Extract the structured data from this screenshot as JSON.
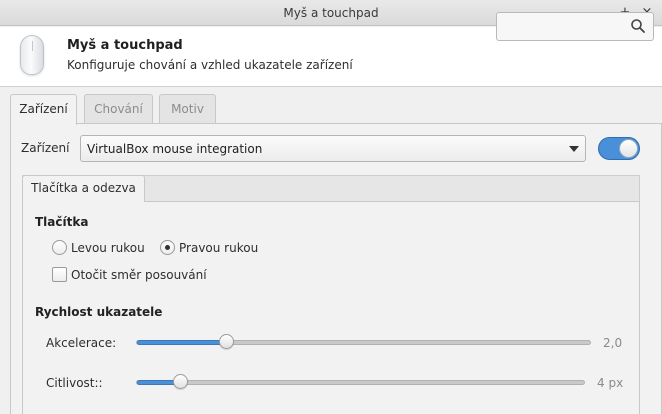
{
  "window": {
    "title": "Myš a touchpad",
    "controls": [
      "–",
      "+",
      "×"
    ]
  },
  "header": {
    "title": "Myš a touchpad",
    "subtitle": "Konfiguruje chování a vzhled ukazatele zařízení",
    "search_value": "",
    "search_icon": "search-icon"
  },
  "tabs": [
    {
      "label": "Zařízení",
      "active": true
    },
    {
      "label": "Chování",
      "active": false
    },
    {
      "label": "Motiv",
      "active": false
    }
  ],
  "device": {
    "label": "Zařízení",
    "selected": "VirtualBox mouse integration",
    "enabled": true
  },
  "subtabs": [
    {
      "label": "Tlačítka a odezva",
      "active": true
    }
  ],
  "buttons_section": {
    "title": "Tlačítka",
    "left_label": "Levou rukou",
    "right_label": "Pravou rukou",
    "selected": "right",
    "reverse_scroll_label": "Otočit směr posouvání",
    "reverse_scroll": false
  },
  "speed_section": {
    "title": "Rychlost ukazatele",
    "acceleration": {
      "label": "Akcelerace:",
      "value_text": "2,0",
      "fraction": 0.2
    },
    "sensitivity": {
      "label": "Citlivost::",
      "value_text": "4 px",
      "fraction": 0.1
    }
  },
  "colors": {
    "accent": "#4a90d9",
    "window_bg": "#f0f0f0"
  }
}
